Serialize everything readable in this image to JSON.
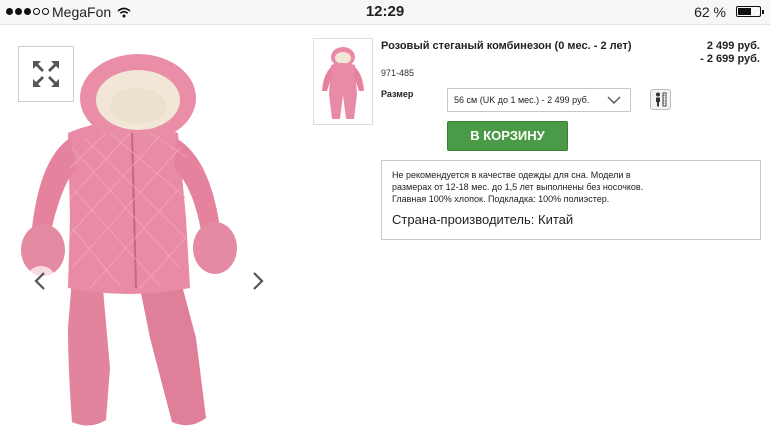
{
  "status_bar": {
    "carrier": "MegaFon",
    "time": "12:29",
    "battery_percent": "62 %",
    "battery_level": 0.62,
    "signal_bars_filled": 3,
    "signal_bars_total": 5
  },
  "gallery": {
    "expand_icon": "expand-arrows-icon",
    "prev_icon": "chevron-left-icon",
    "next_icon": "chevron-right-icon"
  },
  "product": {
    "title": "Розовый стеганый комбинезон (0 мес. - 2 лет)",
    "sku": "971-485",
    "price_from": "2 499 руб.",
    "price_to": "- 2 699 руб.",
    "size_label": "Размер",
    "size_selected": "56 см (UK до 1 мес.) - 2 499 руб.",
    "add_to_cart": "В КОРЗИНУ",
    "accent_color": "#4a9a47"
  },
  "description": {
    "line1": "Не рекомендуется в качестве одежды для сна. Модели в",
    "line2": "размерах от 12-18 мес. до 1,5 лет выполнены без носочков.",
    "line3": "Главная 100% хлопок. Подкладка: 100% полиэстер.",
    "country": "Страна-производитель: Китай"
  }
}
